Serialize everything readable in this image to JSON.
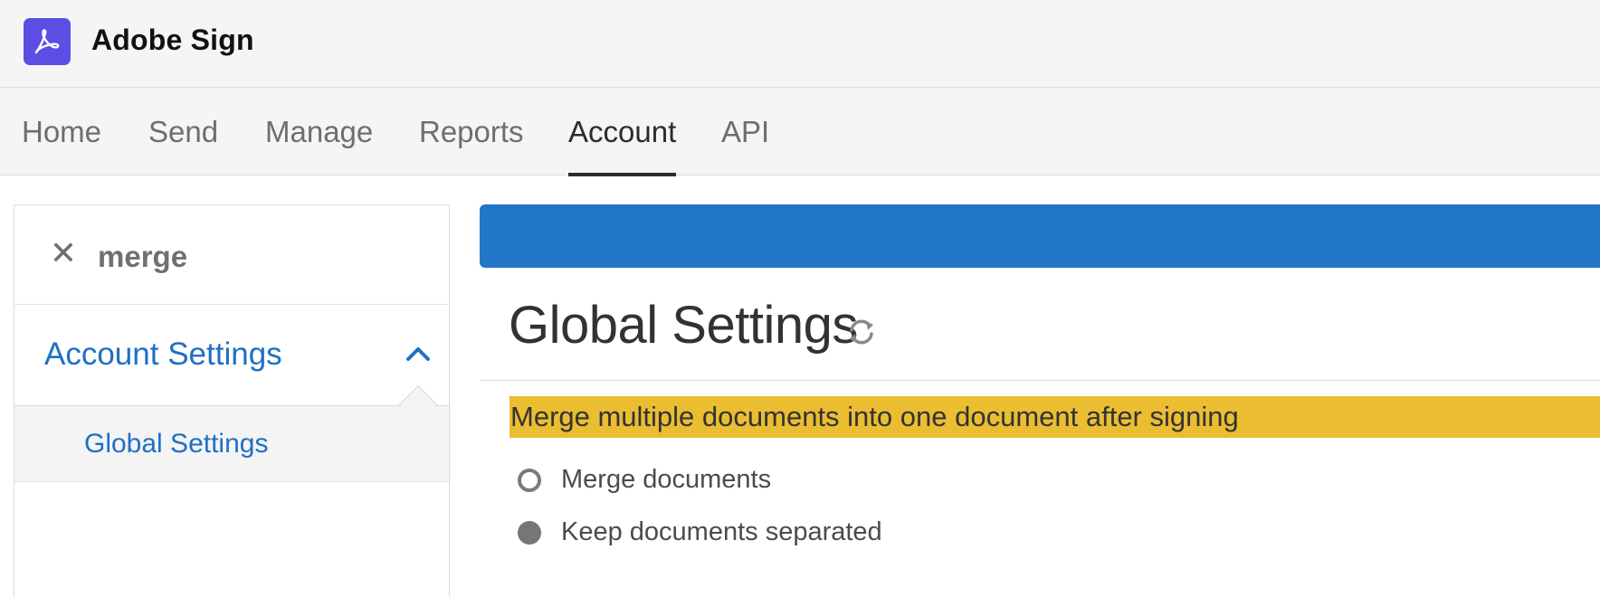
{
  "header": {
    "app_title": "Adobe Sign",
    "logo_icon": "adobe-acrobat-icon",
    "logo_color": "#5c4ee5"
  },
  "nav": {
    "tabs": [
      {
        "label": "Home"
      },
      {
        "label": "Send"
      },
      {
        "label": "Manage"
      },
      {
        "label": "Reports"
      },
      {
        "label": "Account",
        "active": true
      },
      {
        "label": "API"
      }
    ]
  },
  "sidebar": {
    "search_value": "merge",
    "clear_icon": "close-icon",
    "section": {
      "label": "Account Settings",
      "expanded": true,
      "icon": "chevron-up-icon"
    },
    "items": [
      {
        "label": "Global Settings"
      }
    ]
  },
  "main": {
    "banner_color": "#2276c8",
    "page_title": "Global Settings",
    "refresh_icon": "refresh-icon",
    "setting": {
      "label": "Merge multiple documents into one document after signing",
      "highlight_color": "#ebbd30",
      "options": [
        {
          "label": "Merge documents",
          "selected": false
        },
        {
          "label": "Keep documents separated",
          "selected": true
        }
      ]
    }
  },
  "colors": {
    "link_blue": "#1f6fc6"
  }
}
